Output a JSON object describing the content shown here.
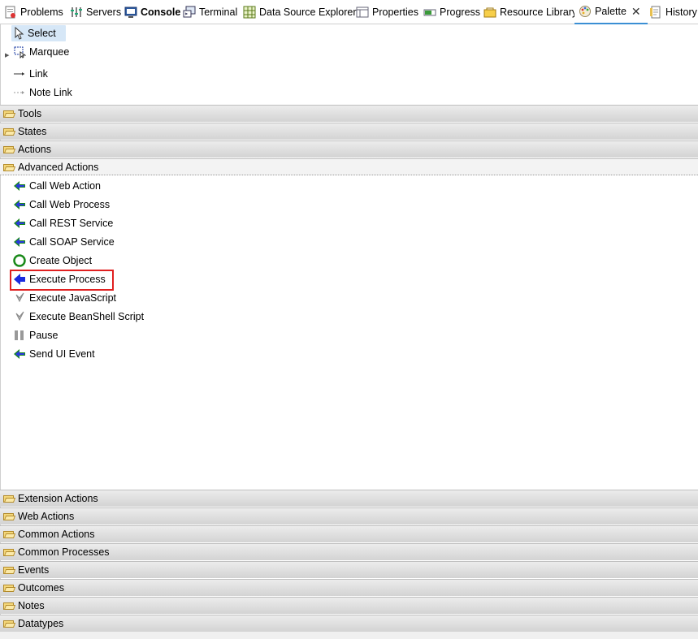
{
  "tabs": [
    {
      "label": "Problems",
      "icon": "problems-icon"
    },
    {
      "label": "Servers",
      "icon": "servers-icon"
    },
    {
      "label": "Console",
      "icon": "console-icon",
      "bold": true
    },
    {
      "label": "Terminal",
      "icon": "terminal-icon"
    },
    {
      "label": "Data Source Explorer",
      "icon": "data-source-icon"
    },
    {
      "label": "Properties",
      "icon": "properties-icon"
    },
    {
      "label": "Progress",
      "icon": "progress-icon"
    },
    {
      "label": "Resource Library",
      "icon": "resource-library-icon"
    },
    {
      "label": "Palette",
      "icon": "palette-icon",
      "active": true
    },
    {
      "label": "History",
      "icon": "history-icon"
    }
  ],
  "palette_tools": [
    {
      "label": "Select",
      "icon": "cursor-icon",
      "selected": true
    },
    {
      "label": "Marquee",
      "icon": "marquee-icon"
    },
    {
      "label": "Link",
      "icon": "link-icon"
    },
    {
      "label": "Note Link",
      "icon": "note-link-icon"
    }
  ],
  "drawers_top": [
    "Tools",
    "States",
    "Actions"
  ],
  "advanced_actions": {
    "label": "Advanced Actions",
    "items": [
      {
        "label": "Call Web Action",
        "icon": "call-arrow-icon"
      },
      {
        "label": "Call Web Process",
        "icon": "call-arrow-icon"
      },
      {
        "label": "Call REST Service",
        "icon": "call-arrow-icon"
      },
      {
        "label": "Call SOAP Service",
        "icon": "call-arrow-icon"
      },
      {
        "label": "Create Object",
        "icon": "create-object-icon"
      },
      {
        "label": "Execute Process",
        "icon": "execute-arrow-icon",
        "highlighted": true
      },
      {
        "label": "Execute JavaScript",
        "icon": "script-icon"
      },
      {
        "label": "Execute BeanShell Script",
        "icon": "script-icon"
      },
      {
        "label": "Pause",
        "icon": "pause-icon"
      },
      {
        "label": "Send UI Event",
        "icon": "call-arrow-icon"
      }
    ]
  },
  "drawers_bottom": [
    "Extension Actions",
    "Web Actions",
    "Common Actions",
    "Common Processes",
    "Events",
    "Outcomes",
    "Notes",
    "Datatypes"
  ],
  "colors": {
    "highlight": "#e02020",
    "tab_active_underline": "#3b8fd4",
    "selection": "#d6e7f7"
  }
}
